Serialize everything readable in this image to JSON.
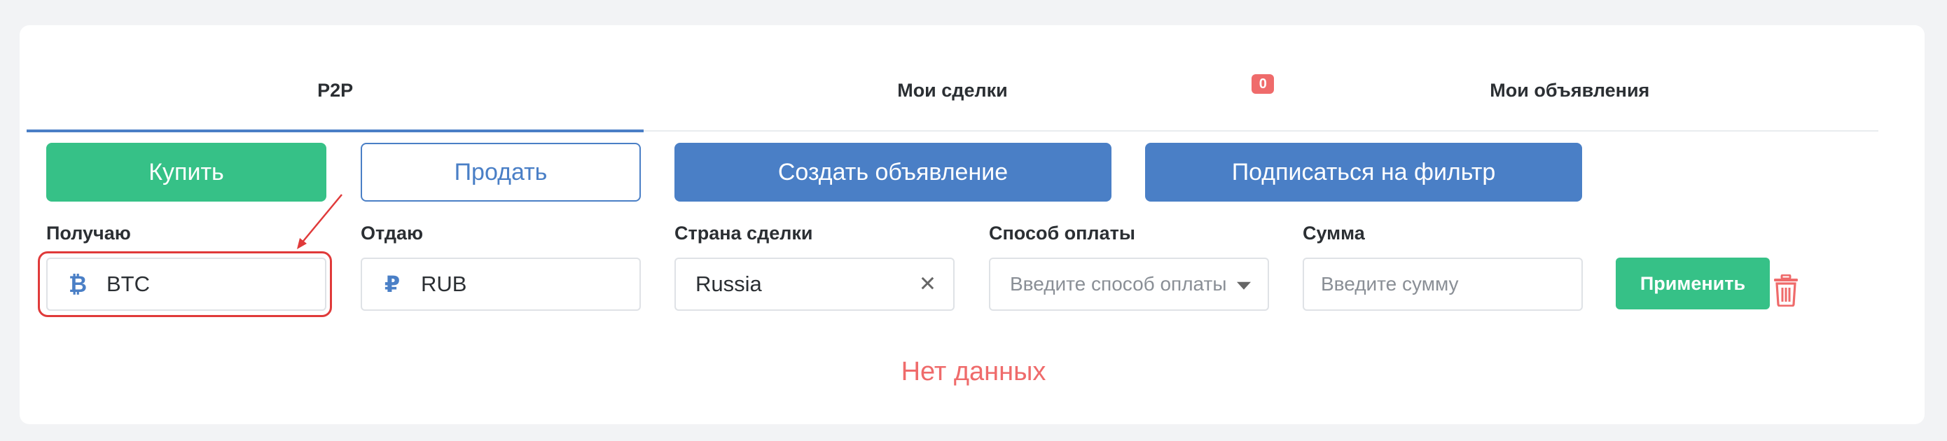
{
  "tabs": [
    {
      "label": "P2P",
      "active": true
    },
    {
      "label": "Мои сделки",
      "active": false
    },
    {
      "label": "Мои объявления",
      "active": false
    }
  ],
  "badge": {
    "count": "0"
  },
  "buttons": {
    "buy": "Купить",
    "sell": "Продать",
    "create_ad": "Создать объявление",
    "subscribe": "Подписаться на фильтр"
  },
  "filters": {
    "receive": {
      "label": "Получаю",
      "value": "BTC",
      "icon": "bitcoin-icon",
      "icon_glyph": "₿"
    },
    "give": {
      "label": "Отдаю",
      "value": "RUB",
      "icon": "ruble-icon",
      "icon_glyph": "₽"
    },
    "country": {
      "label": "Страна сделки",
      "value": "Russia"
    },
    "payment": {
      "label": "Способ оплаты",
      "placeholder": "Введите способ оплаты"
    },
    "amount": {
      "label": "Сумма",
      "placeholder": "Введите сумму"
    }
  },
  "apply_label": "Применить",
  "empty_text": "Нет данных",
  "colors": {
    "green": "#36c187",
    "blue": "#4a7fc6",
    "red": "#ef6b6b",
    "annotation_red": "#e03a3a"
  }
}
